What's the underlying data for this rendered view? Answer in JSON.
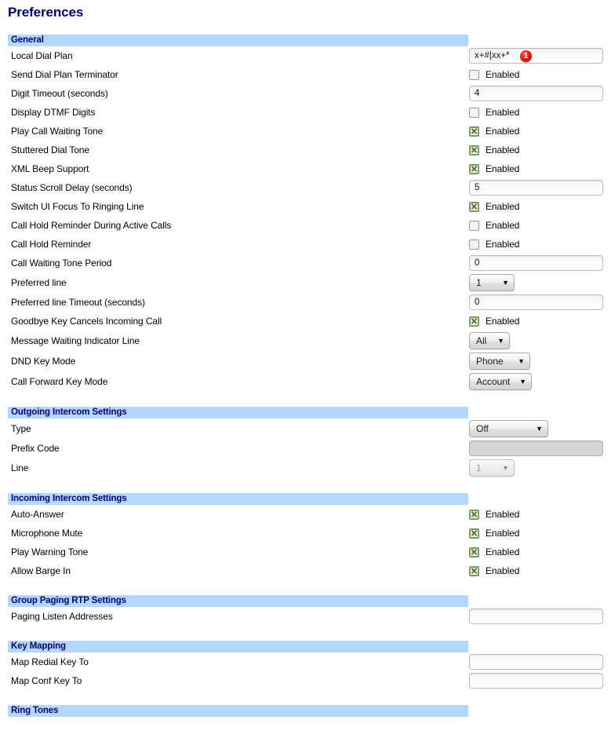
{
  "page": {
    "title": "Preferences"
  },
  "labels": {
    "enabled": "Enabled"
  },
  "colors": {
    "section_bar": "#b4d7fc",
    "section_text": "#000080",
    "title": "#000080",
    "badge": "#e51010",
    "checkbox_check": "#4f7c2a"
  },
  "sections": [
    {
      "name": "general",
      "title": "General",
      "rows": [
        {
          "label": "Local Dial Plan",
          "type": "text",
          "value": "x+#|xx+*",
          "badge": "1"
        },
        {
          "label": "Send Dial Plan Terminator",
          "type": "checkbox",
          "checked": false,
          "text": "Enabled"
        },
        {
          "label": "Digit Timeout (seconds)",
          "type": "text",
          "value": "4"
        },
        {
          "label": "Display DTMF Digits",
          "type": "checkbox",
          "checked": false,
          "text": "Enabled"
        },
        {
          "label": "Play Call Waiting Tone",
          "type": "checkbox",
          "checked": true,
          "text": "Enabled"
        },
        {
          "label": "Stuttered Dial Tone",
          "type": "checkbox",
          "checked": true,
          "text": "Enabled"
        },
        {
          "label": "XML Beep Support",
          "type": "checkbox",
          "checked": true,
          "text": "Enabled"
        },
        {
          "label": "Status Scroll Delay (seconds)",
          "type": "text",
          "value": "5"
        },
        {
          "label": "Switch UI Focus To Ringing Line",
          "type": "checkbox",
          "checked": true,
          "text": "Enabled"
        },
        {
          "label": "Call Hold Reminder During Active Calls",
          "type": "checkbox",
          "checked": false,
          "text": "Enabled"
        },
        {
          "label": "Call Hold Reminder",
          "type": "checkbox",
          "checked": false,
          "text": "Enabled"
        },
        {
          "label": "Call Waiting Tone Period",
          "type": "text",
          "value": "0"
        },
        {
          "label": "Preferred line",
          "type": "select",
          "value": "1",
          "width": "w-sm"
        },
        {
          "label": "Preferred line Timeout (seconds)",
          "type": "text",
          "value": "0"
        },
        {
          "label": "Goodbye Key Cancels Incoming Call",
          "type": "checkbox",
          "checked": true,
          "text": "Enabled"
        },
        {
          "label": "Message Waiting Indicator Line",
          "type": "select",
          "value": "All",
          "width": "w-all"
        },
        {
          "label": "DND Key Mode",
          "type": "select",
          "value": "Phone",
          "width": "w-md"
        },
        {
          "label": "Call Forward Key Mode",
          "type": "select",
          "value": "Account",
          "width": "w-acct"
        }
      ]
    },
    {
      "name": "outgoing-intercom-settings",
      "title": "Outgoing Intercom Settings",
      "rows": [
        {
          "label": "Type",
          "type": "select",
          "value": "Off",
          "width": "w-lg"
        },
        {
          "label": "Prefix Code",
          "type": "text",
          "value": "",
          "disabled": true
        },
        {
          "label": "Line",
          "type": "select",
          "value": "1",
          "width": "w-sm",
          "disabled": true
        }
      ]
    },
    {
      "name": "incoming-intercom-settings",
      "title": "Incoming Intercom Settings",
      "rows": [
        {
          "label": "Auto-Answer",
          "type": "checkbox",
          "checked": true,
          "text": "Enabled"
        },
        {
          "label": "Microphone Mute",
          "type": "checkbox",
          "checked": true,
          "text": "Enabled"
        },
        {
          "label": "Play Warning Tone",
          "type": "checkbox",
          "checked": true,
          "text": "Enabled"
        },
        {
          "label": "Allow Barge In",
          "type": "checkbox",
          "checked": true,
          "text": "Enabled"
        }
      ]
    },
    {
      "name": "group-paging-rtp-settings",
      "title": "Group Paging RTP Settings",
      "rows": [
        {
          "label": "Paging Listen Addresses",
          "type": "text",
          "value": ""
        }
      ]
    },
    {
      "name": "key-mapping",
      "title": "Key Mapping",
      "rows": [
        {
          "label": "Map Redial Key To",
          "type": "text",
          "value": ""
        },
        {
          "label": "Map Conf Key To",
          "type": "text",
          "value": ""
        }
      ]
    },
    {
      "name": "ring-tones",
      "title": "Ring Tones",
      "rows": []
    }
  ]
}
